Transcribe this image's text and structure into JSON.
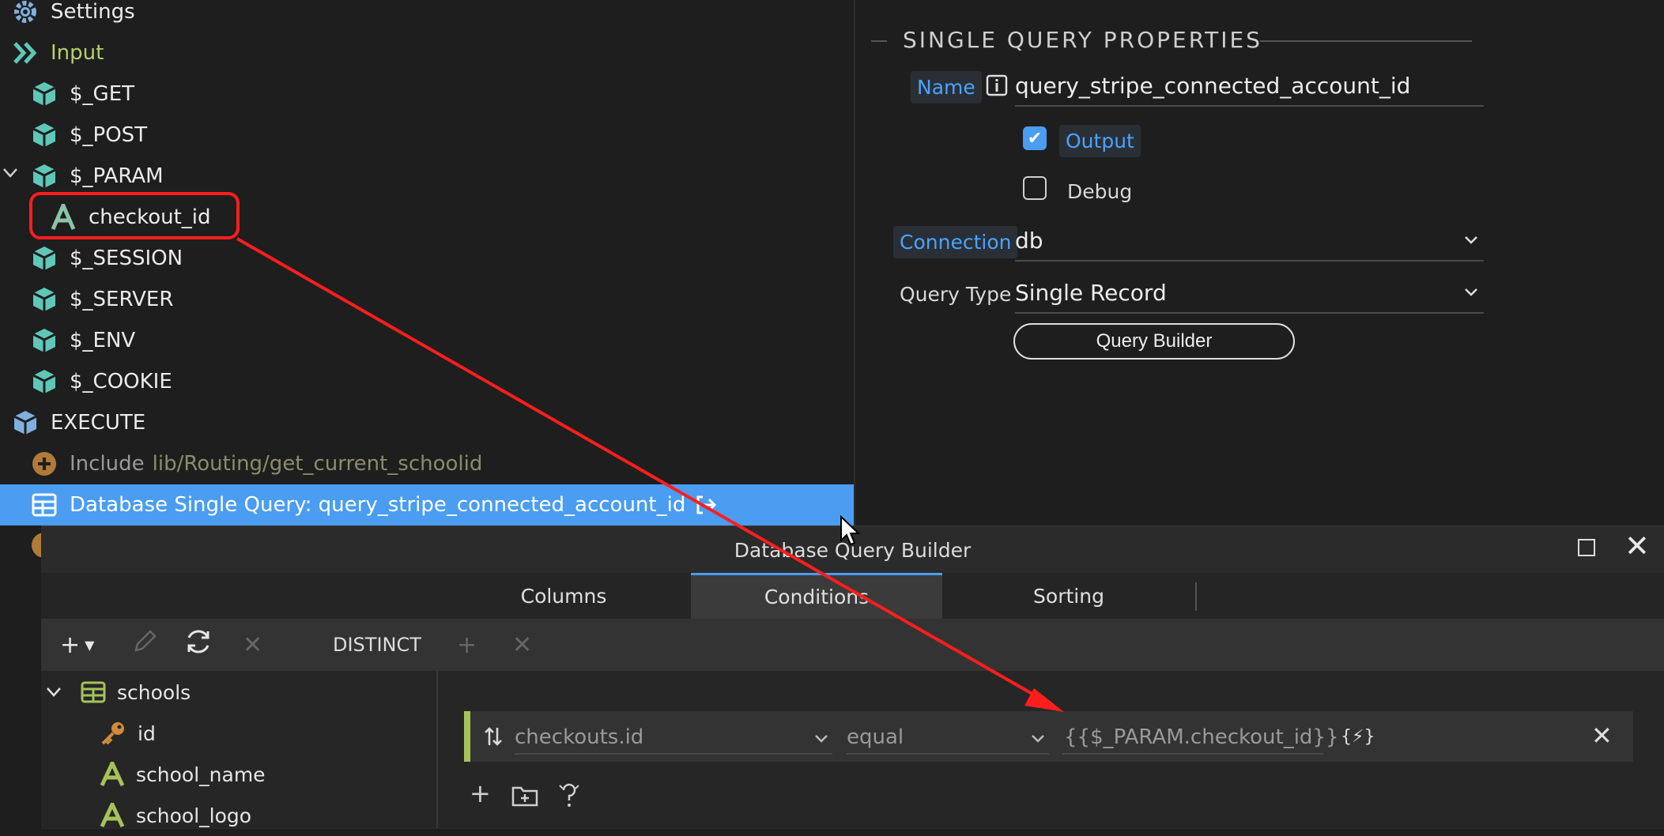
{
  "tree": {
    "items": [
      {
        "label": "Settings",
        "icon": "gear-icon"
      },
      {
        "label": "Input",
        "icon": "double-chevron-icon"
      },
      {
        "label": "$_GET",
        "icon": "cube-icon"
      },
      {
        "label": "$_POST",
        "icon": "cube-icon"
      },
      {
        "label": "$_PARAM",
        "icon": "cube-icon"
      },
      {
        "label": "checkout_id",
        "icon": "text-type-icon"
      },
      {
        "label": "$_SESSION",
        "icon": "cube-icon"
      },
      {
        "label": "$_SERVER",
        "icon": "cube-icon"
      },
      {
        "label": "$_ENV",
        "icon": "cube-icon"
      },
      {
        "label": "$_COOKIE",
        "icon": "cube-icon"
      },
      {
        "label": "EXECUTE",
        "icon": "cube-icon"
      },
      {
        "label": "Include",
        "path": "lib/Routing/get_current_schoolid",
        "icon": "plus-circle-icon"
      },
      {
        "label": "Database Single Query: query_stripe_connected_account_id",
        "icon": "table-icon"
      }
    ]
  },
  "props": {
    "section_title": "SINGLE QUERY PROPERTIES",
    "name_label": "Name",
    "name_value": "query_stripe_connected_account_id",
    "output_label": "Output",
    "output_checked": true,
    "debug_label": "Debug",
    "debug_checked": false,
    "connection_label": "Connection",
    "connection_value": "db",
    "query_type_label": "Query Type",
    "query_type_value": "Single Record",
    "query_builder_label": "Query Builder"
  },
  "dialog": {
    "title": "Database Query Builder",
    "tabs": [
      {
        "label": "Columns",
        "active": false
      },
      {
        "label": "Conditions",
        "active": true
      },
      {
        "label": "Sorting",
        "active": false
      }
    ],
    "toolbar": {
      "distinct_label": "DISTINCT"
    },
    "tables": {
      "table_name": "schools",
      "columns": [
        {
          "name": "id",
          "icon": "key-icon"
        },
        {
          "name": "school_name",
          "icon": "text-type-icon"
        },
        {
          "name": "school_logo",
          "icon": "text-type-icon"
        }
      ]
    },
    "condition": {
      "field": "checkouts.id",
      "operator": "equal",
      "value": "{{$_PARAM.checkout_id}}",
      "dynamic_icon_label": "{⚡}"
    }
  },
  "colors": {
    "accent": "#4a9df0",
    "highlight": "#ff1d1d",
    "condition_bar": "#a6c35a",
    "cube": "#5fc7b8"
  }
}
